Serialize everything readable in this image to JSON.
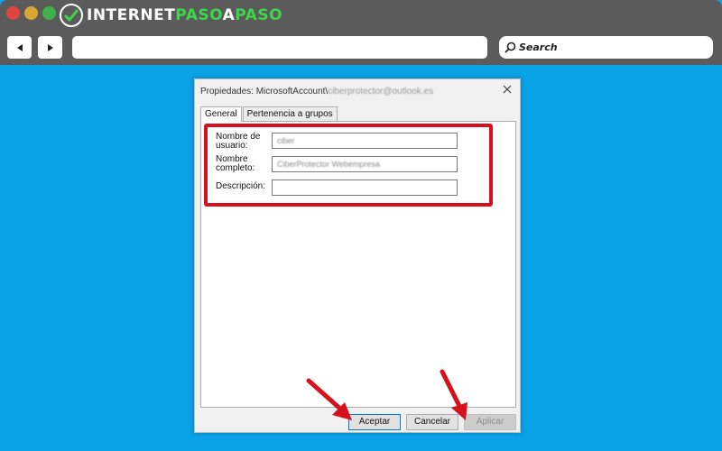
{
  "browser": {
    "logo": {
      "part1": "INTERNET",
      "part2": "PASO",
      "part3": "A",
      "part4": "PASO"
    },
    "search_label": "Search",
    "url": ""
  },
  "dialog": {
    "title_prefix": "Propiedades: MicrosoftAccount\\",
    "title_email": "ciberprotector@outlook.es",
    "tabs": [
      {
        "label": "General",
        "active": true
      },
      {
        "label": "Pertenencia a grupos",
        "active": false
      }
    ],
    "fields": {
      "username": {
        "label_line1": "Nombre de",
        "label_line2": "usuario:",
        "value": "ciber"
      },
      "fullname": {
        "label_line1": "Nombre",
        "label_line2": "completo:",
        "value": "CiberProtector Webempresa"
      },
      "description": {
        "label": "Descripción:",
        "value": ""
      }
    },
    "buttons": {
      "ok": "Aceptar",
      "cancel": "Cancelar",
      "apply": "Aplicar"
    }
  },
  "colors": {
    "background": "#0aa3e8",
    "highlight": "#d6101c",
    "arrow": "#d6101c"
  }
}
